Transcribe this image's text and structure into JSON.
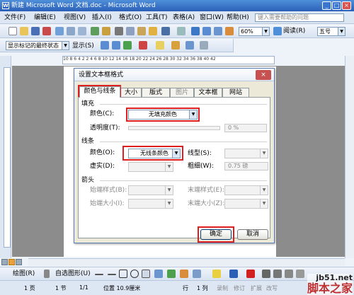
{
  "window": {
    "title": "新建 Microsoft Word 文档.doc - Microsoft Word",
    "icon": "word-doc-icon",
    "min": "_",
    "max": "□",
    "close": "×"
  },
  "menu": [
    "文件(F)",
    "编辑(E)",
    "视图(V)",
    "插入(I)",
    "格式(O)",
    "工具(T)",
    "表格(A)",
    "窗口(W)",
    "帮助(H)"
  ],
  "help_placeholder": "键入需要帮助的问题",
  "toolbar": {
    "zoom": "60%",
    "read": "阅读(R)",
    "font_size": "五号"
  },
  "review": {
    "show_markup": "显示标记的最终状态",
    "show": "显示(S)"
  },
  "ruler": {
    "ticks": "10  8  6  4  2     2  4  6  8  10  12  14  16  18  20  22  24  26  28  30  32  34  36  38  40  42"
  },
  "dialog": {
    "title": "设置文本框格式",
    "close": "×",
    "tabs": [
      "颜色与线条",
      "大小",
      "版式",
      "图片",
      "文本框",
      "网站"
    ],
    "fill": {
      "section": "填充",
      "color_label": "颜色(C):",
      "color_value": "无填充颜色",
      "transparency_label": "透明度(T):",
      "transparency_value": "0 %"
    },
    "line": {
      "section": "线条",
      "color_label": "颜色(O):",
      "color_value": "无线条颜色",
      "style_label": "线型(S):",
      "dash_label": "虚实(D):",
      "weight_label": "粗细(W):",
      "weight_value": "0.75 磅"
    },
    "arrows": {
      "section": "箭头",
      "begin_style": "始端样式(B):",
      "end_style": "末端样式(E):",
      "begin_size": "始端大小(I):",
      "end_size": "末端大小(Z):"
    },
    "ok": "确定",
    "cancel": "取消"
  },
  "drawing": {
    "draw": "绘图(R)",
    "autoshapes": "自选图形(U)"
  },
  "status": {
    "page": "1 页",
    "section": "1 节",
    "pos": "1/1",
    "at": "位置 10.9厘米",
    "line": "行",
    "col": "1 列",
    "rec": "录制",
    "trk": "修订",
    "ext": "扩展",
    "ovr": "改写"
  },
  "watermark": {
    "site": "jb51.net",
    "name": "脚本之家"
  },
  "colors": {
    "highlight": "#e02020",
    "title_blue": "#2a5fb8"
  }
}
